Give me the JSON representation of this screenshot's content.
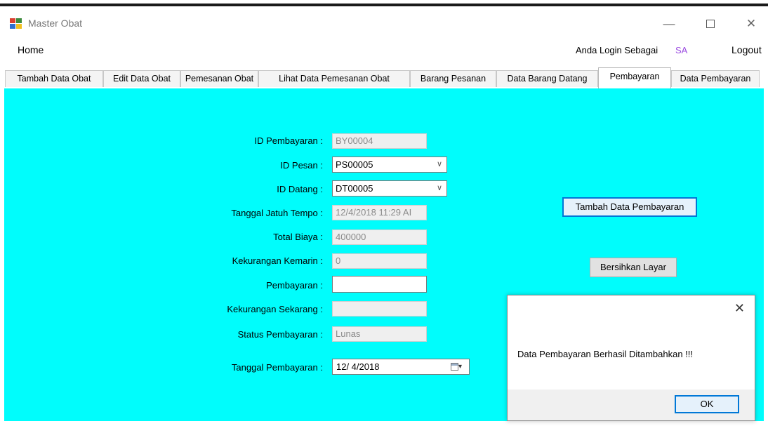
{
  "window": {
    "title": "Master Obat",
    "icon": "app-window-icon",
    "controls": {
      "minimize": "—",
      "maximize": "☐",
      "close": "✕"
    }
  },
  "menu": {
    "home": "Home",
    "login_label": "Anda Login Sebagai",
    "login_user": "SA",
    "logout": "Logout"
  },
  "tabs": [
    {
      "label": "Tambah Data Obat"
    },
    {
      "label": "Edit Data Obat"
    },
    {
      "label": "Pemesanan Obat"
    },
    {
      "label": "Lihat Data Pemesanan Obat"
    },
    {
      "label": "Barang Pesanan"
    },
    {
      "label": "Data Barang Datang"
    },
    {
      "label": "Pembayaran",
      "active": true
    },
    {
      "label": "Data Pembayaran"
    }
  ],
  "form": {
    "id_pembayaran": {
      "label": "ID Pembayaran :",
      "value": "BY00004"
    },
    "id_pesan": {
      "label": "ID Pesan :",
      "value": "PS00005"
    },
    "id_datang": {
      "label": "ID Datang :",
      "value": "DT00005"
    },
    "tanggal_jatuh_tempo": {
      "label": "Tanggal Jatuh Tempo :",
      "value": "12/4/2018 11:29 AI"
    },
    "total_biaya": {
      "label": "Total Biaya :",
      "value": "400000"
    },
    "kekurangan_kemarin": {
      "label": "Kekurangan Kemarin :",
      "value": "0"
    },
    "pembayaran": {
      "label": "Pembayaran :",
      "value": ""
    },
    "kekurangan_sekarang": {
      "label": "Kekurangan Sekarang :",
      "value": ""
    },
    "status_pembayaran": {
      "label": "Status Pembayaran :",
      "value": "Lunas"
    },
    "tanggal_pembayaran": {
      "label": "Tanggal Pembayaran :",
      "value": "12/ 4/2018"
    }
  },
  "buttons": {
    "tambah": "Tambah Data Pembayaran",
    "bersihkan": "Bersihkan Layar"
  },
  "dialog": {
    "message": "Data Pembayaran Berhasil Ditambahkan !!!",
    "ok": "OK",
    "close": "✕"
  },
  "colors": {
    "content_bg": "#00fdfc",
    "login_user": "#9b4ce0",
    "focus_border": "#0078d7"
  }
}
